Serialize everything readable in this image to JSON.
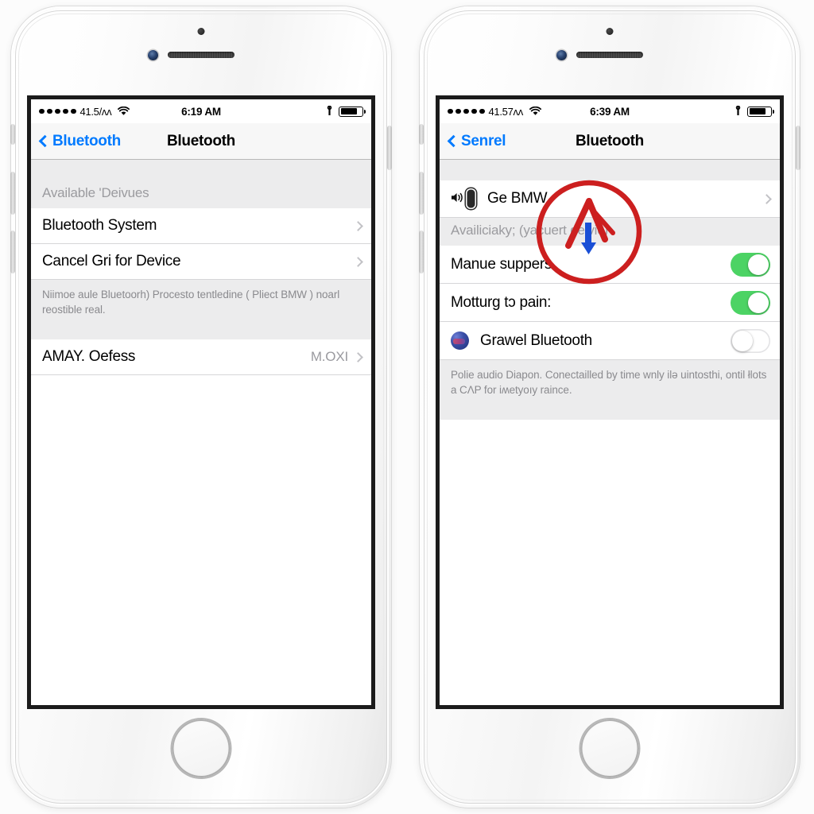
{
  "meta": {
    "accent_blue": "#007aff",
    "switch_green": "#4cd364",
    "annotation_red": "#cc1f1f",
    "annotation_blue": "#1a4fd6",
    "group_bg": "#ececed"
  },
  "phones": [
    {
      "id": "left",
      "status_bar": {
        "signal_dots": 5,
        "carrier": "41.5/ʌʌ",
        "wifi_icon": "wifi-icon",
        "time": "6:19 AM",
        "alarm_icon": "alarm-icon",
        "battery_icon": "battery-icon",
        "battery_level_pct": 70
      },
      "nav": {
        "back_label": "Bluetooth",
        "back_icon": "chevron-left-icon",
        "title": "Bluetooth"
      },
      "sections": [
        {
          "header": "Available 'Deivues",
          "rows": [
            {
              "label": "Bluetooth System",
              "accessory": "chevron"
            },
            {
              "label": "Cancel Gri for Device",
              "accessory": "chevron"
            }
          ],
          "footnote": "Niimoe aule Bluetoorh) Procesto tentledine ( Pliect BMW ) noarl reostible real."
        },
        {
          "rows": [
            {
              "label": "AMAY. Oefess",
              "value": "M.OΧI",
              "accessory": "chevron"
            }
          ]
        }
      ]
    },
    {
      "id": "right",
      "status_bar": {
        "signal_dots": 5,
        "carrier": "41.57ʌʌ",
        "wifi_icon": "wifi-icon",
        "time": "6:39 AM",
        "alarm_icon": "alarm-icon",
        "battery_icon": "battery-icon",
        "battery_level_pct": 70
      },
      "nav": {
        "back_label": "Senrel",
        "back_icon": "chevron-left-icon",
        "title": "Bluetooth"
      },
      "sections": [
        {
          "rows": [
            {
              "label": "Ge BMW",
              "icons": [
                "speaker-icon",
                "device-icon"
              ],
              "accessory": "chevron"
            }
          ]
        },
        {
          "header": "Availiciaky; (yacuert delvic)",
          "rows": [
            {
              "label": "Manue suppers",
              "toggle": "on"
            },
            {
              "label": "Motturg tɔ pain:",
              "toggle": "on"
            },
            {
              "label": "Grawel Bluetooth",
              "icon": "app-icon",
              "toggle": "off"
            }
          ],
          "footnote": "Polie audio Diapon. Conectailled by time wnly ilə uintosthi, ontil łlots a CΛP for iʍetyoıy raince."
        }
      ],
      "annotation": {
        "circle": "hand-drawn-red-circle",
        "caret": "red-caret-arrow",
        "arrow": "blue-down-arrow"
      }
    }
  ]
}
